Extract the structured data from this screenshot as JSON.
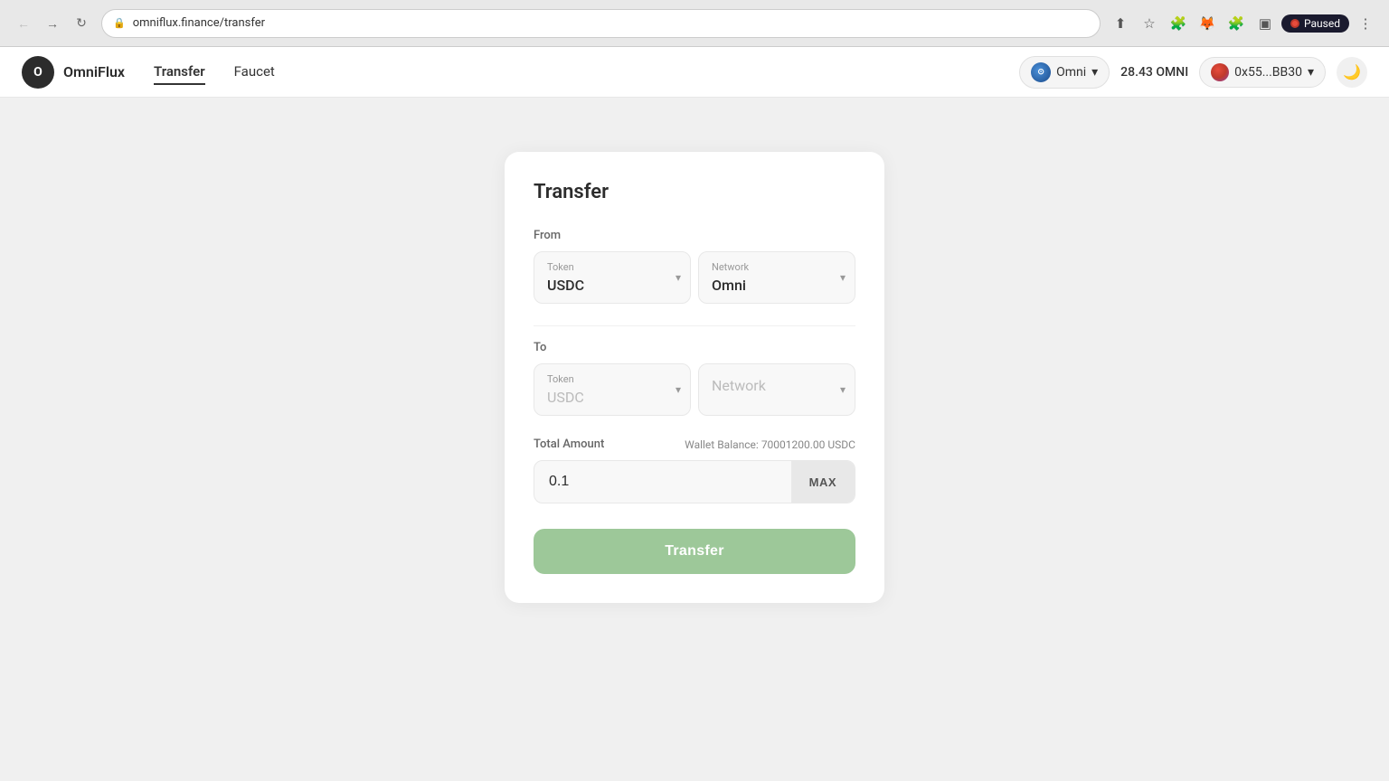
{
  "browser": {
    "url": "omniflux.finance/transfer",
    "paused_label": "Paused"
  },
  "header": {
    "logo_text": "OmniFlux",
    "logo_initial": "O",
    "nav": [
      {
        "label": "Transfer",
        "active": true
      },
      {
        "label": "Faucet",
        "active": false
      }
    ],
    "network": {
      "name": "Omni",
      "chevron": "▾"
    },
    "balance": "28.43 OMNI",
    "wallet_address": "0x55...BB30",
    "wallet_chevron": "▾"
  },
  "transfer_card": {
    "title": "Transfer",
    "from_section": {
      "label": "From",
      "token_label": "Token",
      "token_value": "USDC",
      "network_label": "Network",
      "network_value": "Omni"
    },
    "to_section": {
      "label": "To",
      "token_label": "Token",
      "token_value": "USDC",
      "network_label": "Network",
      "network_placeholder": "Network"
    },
    "amount_section": {
      "label": "Total Amount",
      "wallet_balance_label": "Wallet Balance:",
      "wallet_balance_value": "70001200.00 USDC",
      "amount_value": "0.1",
      "max_label": "MAX"
    },
    "transfer_button_label": "Transfer"
  }
}
